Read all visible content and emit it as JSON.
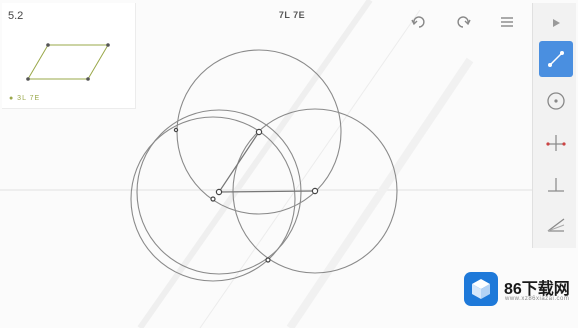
{
  "level": {
    "number": "5.2",
    "stats": "● 3L 7E"
  },
  "goal": {
    "label": "7L 7E"
  },
  "toolbar": {
    "undo_icon": "undo-icon",
    "redo_icon": "redo-icon",
    "menu_icon": "menu-icon"
  },
  "tools": [
    {
      "name": "point-tool",
      "icon": "point-icon"
    },
    {
      "name": "line-tool",
      "icon": "line-icon",
      "active": true
    },
    {
      "name": "circle-tool",
      "icon": "circle-icon"
    },
    {
      "name": "bisector-tool",
      "icon": "perpendicular-bisector-icon"
    },
    {
      "name": "perpendicular-tool",
      "icon": "perpendicular-icon"
    },
    {
      "name": "angle-bisector-tool",
      "icon": "angle-bisector-icon"
    }
  ],
  "colors": {
    "accent": "#4a8fe0",
    "construction": "#8a8a8a",
    "watermark_blue": "#1e79d9"
  },
  "watermark": {
    "title": "86下载网",
    "subtitle": "www.xz86xiazai.com"
  }
}
